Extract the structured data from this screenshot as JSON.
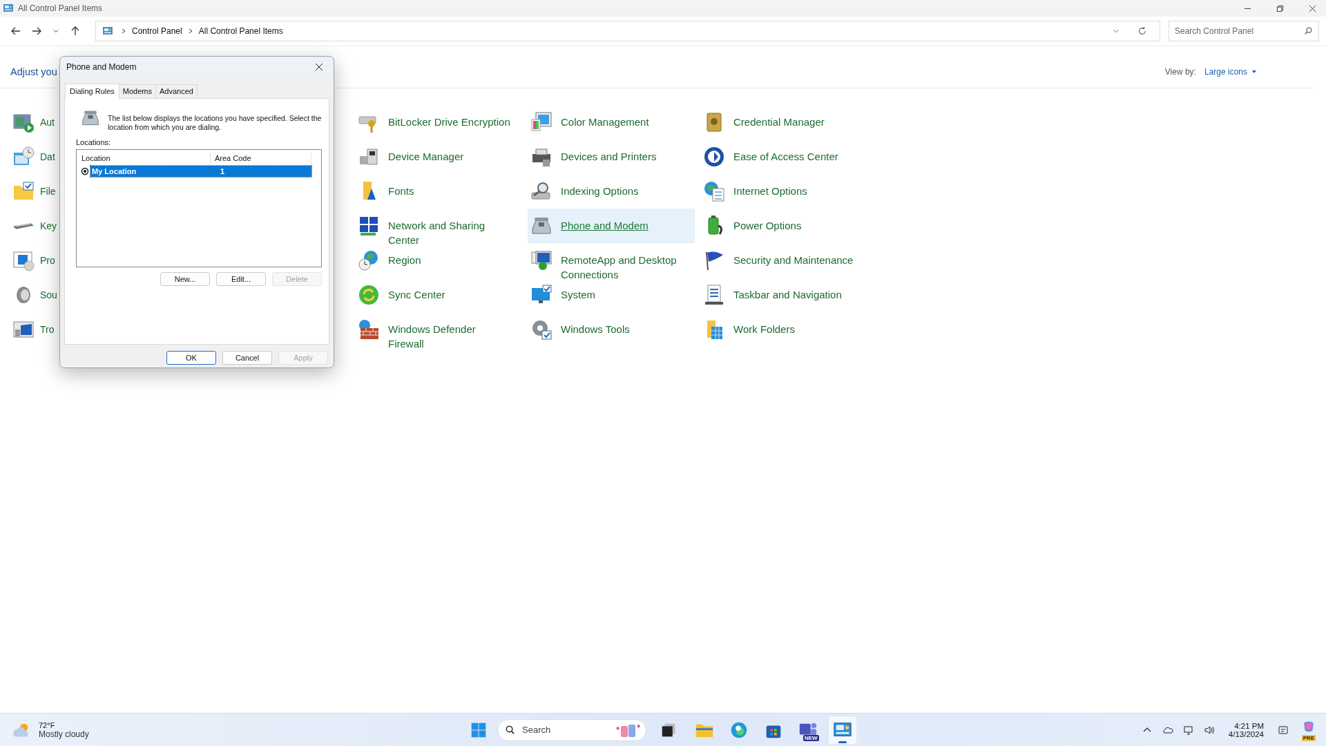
{
  "window": {
    "title": "All Control Panel Items"
  },
  "address_bar": {
    "breadcrumbs": [
      "Control Panel",
      "All Control Panel Items"
    ]
  },
  "search": {
    "placeholder": "Search Control Panel"
  },
  "header": {
    "title": "Adjust you",
    "view_by_label": "View by:",
    "view_by_value": "Large icons"
  },
  "left_items": [
    "Aut",
    "Dat",
    "File",
    "Key",
    "Pro",
    "Sou",
    "Tro"
  ],
  "items": [
    {
      "label": "BitLocker Drive Encryption",
      "selected": false
    },
    {
      "label": "Color Management",
      "selected": false
    },
    {
      "label": "Credential Manager",
      "selected": false
    },
    {
      "label": "Device Manager",
      "selected": false
    },
    {
      "label": "Devices and Printers",
      "selected": false
    },
    {
      "label": "Ease of Access Center",
      "selected": false
    },
    {
      "label": "Fonts",
      "selected": false
    },
    {
      "label": "Indexing Options",
      "selected": false
    },
    {
      "label": "Internet Options",
      "selected": false
    },
    {
      "label": "Network and Sharing Center",
      "selected": false
    },
    {
      "label": "Phone and Modem",
      "selected": true
    },
    {
      "label": "Power Options",
      "selected": false
    },
    {
      "label": "Region",
      "selected": false
    },
    {
      "label": "RemoteApp and Desktop Connections",
      "selected": false
    },
    {
      "label": "Security and Maintenance",
      "selected": false
    },
    {
      "label": "Sync Center",
      "selected": false
    },
    {
      "label": "System",
      "selected": false
    },
    {
      "label": "Taskbar and Navigation",
      "selected": false
    },
    {
      "label": "Windows Defender Firewall",
      "selected": false
    },
    {
      "label": "Windows Tools",
      "selected": false
    },
    {
      "label": "Work Folders",
      "selected": false
    }
  ],
  "dialog": {
    "title": "Phone and Modem",
    "tabs": [
      {
        "label": "Dialing Rules",
        "selected": true
      },
      {
        "label": "Modems",
        "selected": false
      },
      {
        "label": "Advanced",
        "selected": false
      }
    ],
    "description": "The list below displays the locations you have specified. Select the location from which you are dialing.",
    "locations_label": "Locations:",
    "columns": [
      "Location",
      "Area Code"
    ],
    "rows": [
      {
        "location": "My Location",
        "area_code": "1",
        "selected": true,
        "current": true
      }
    ],
    "list_buttons": [
      {
        "label": "New...",
        "disabled": false
      },
      {
        "label": "Edit...",
        "disabled": false
      },
      {
        "label": "Delete",
        "disabled": true
      }
    ],
    "buttons": [
      {
        "label": "OK",
        "disabled": false
      },
      {
        "label": "Cancel",
        "disabled": false
      },
      {
        "label": "Apply",
        "disabled": true
      }
    ]
  },
  "taskbar": {
    "weather": {
      "temperature": "72°F",
      "condition": "Mostly cloudy"
    },
    "search_placeholder": "Search",
    "apps": [
      {
        "selected": false
      },
      {
        "selected": false
      },
      {
        "selected": false
      },
      {
        "selected": false
      },
      {
        "selected": false,
        "badge": "NEW"
      },
      {
        "selected": true
      }
    ],
    "copilot_badge": "PRE",
    "time": "4:21 PM",
    "date": "4/13/2024"
  }
}
